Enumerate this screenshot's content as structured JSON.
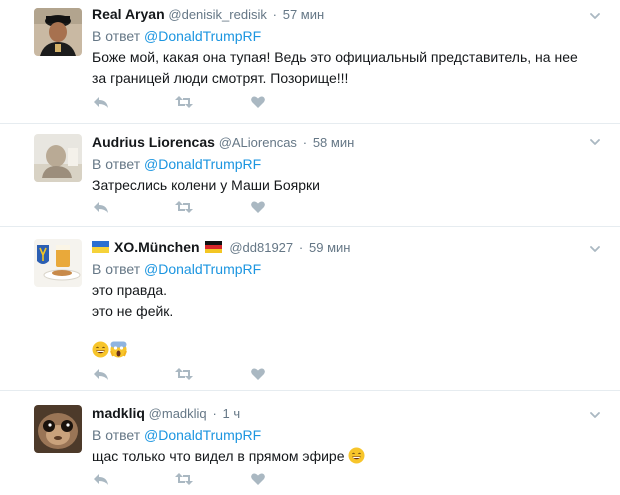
{
  "tweets": [
    {
      "name": "Real Aryan",
      "handle": "@denisik_redisik",
      "time": "57 мин",
      "reply_prefix": "В ответ",
      "reply_to": "@DonaldTrumpRF",
      "lines": [
        "Боже мой, какая она тупая! Ведь это официальный представитель, на нее",
        "за границей люди смотрят. Позорище!!!"
      ]
    },
    {
      "name": "Audrius Liorencas",
      "handle": "@ALiorencas",
      "time": "58 мин",
      "reply_prefix": "В ответ",
      "reply_to": "@DonaldTrumpRF",
      "lines": [
        "Затреслись колени у Маши Боярки"
      ]
    },
    {
      "name": "XO.München",
      "handle": "@dd81927",
      "time": "59 мин",
      "reply_prefix": "В ответ",
      "reply_to": "@DonaldTrumpRF",
      "lines": [
        "это правда.",
        "это не фейк."
      ],
      "emojis": [
        "grinning-face-emoji",
        "screaming-face-emoji"
      ]
    },
    {
      "name": "madkliq",
      "handle": "@madkliq",
      "time": "1 ч",
      "reply_prefix": "В ответ",
      "reply_to": "@DonaldTrumpRF",
      "lines": [
        "щас только что видел в прямом эфире"
      ],
      "emojis": [
        "grinning-face-emoji"
      ]
    }
  ],
  "icons": {
    "reply": "reply-icon",
    "retweet": "retweet-icon",
    "like": "heart-icon",
    "more": "chevron-down-icon"
  },
  "colors": {
    "link": "#1b95e0",
    "muted": "#657786",
    "icon": "#aab8c2",
    "divider": "#e6ecf0"
  }
}
